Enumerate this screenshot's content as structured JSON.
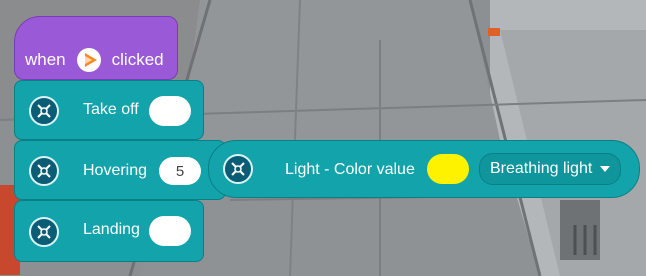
{
  "hat_block": {
    "when": "when",
    "clicked": "clicked"
  },
  "blocks": {
    "take_off": {
      "label": "Take off"
    },
    "hovering": {
      "label": "Hovering",
      "value": "5"
    },
    "light": {
      "label": "Light - Color value",
      "color": "#fff200",
      "mode": "Breathing light"
    },
    "landing": {
      "label": "Landing"
    }
  },
  "icons": {
    "flag": "green-flag-icon",
    "drone": "drone-icon"
  }
}
